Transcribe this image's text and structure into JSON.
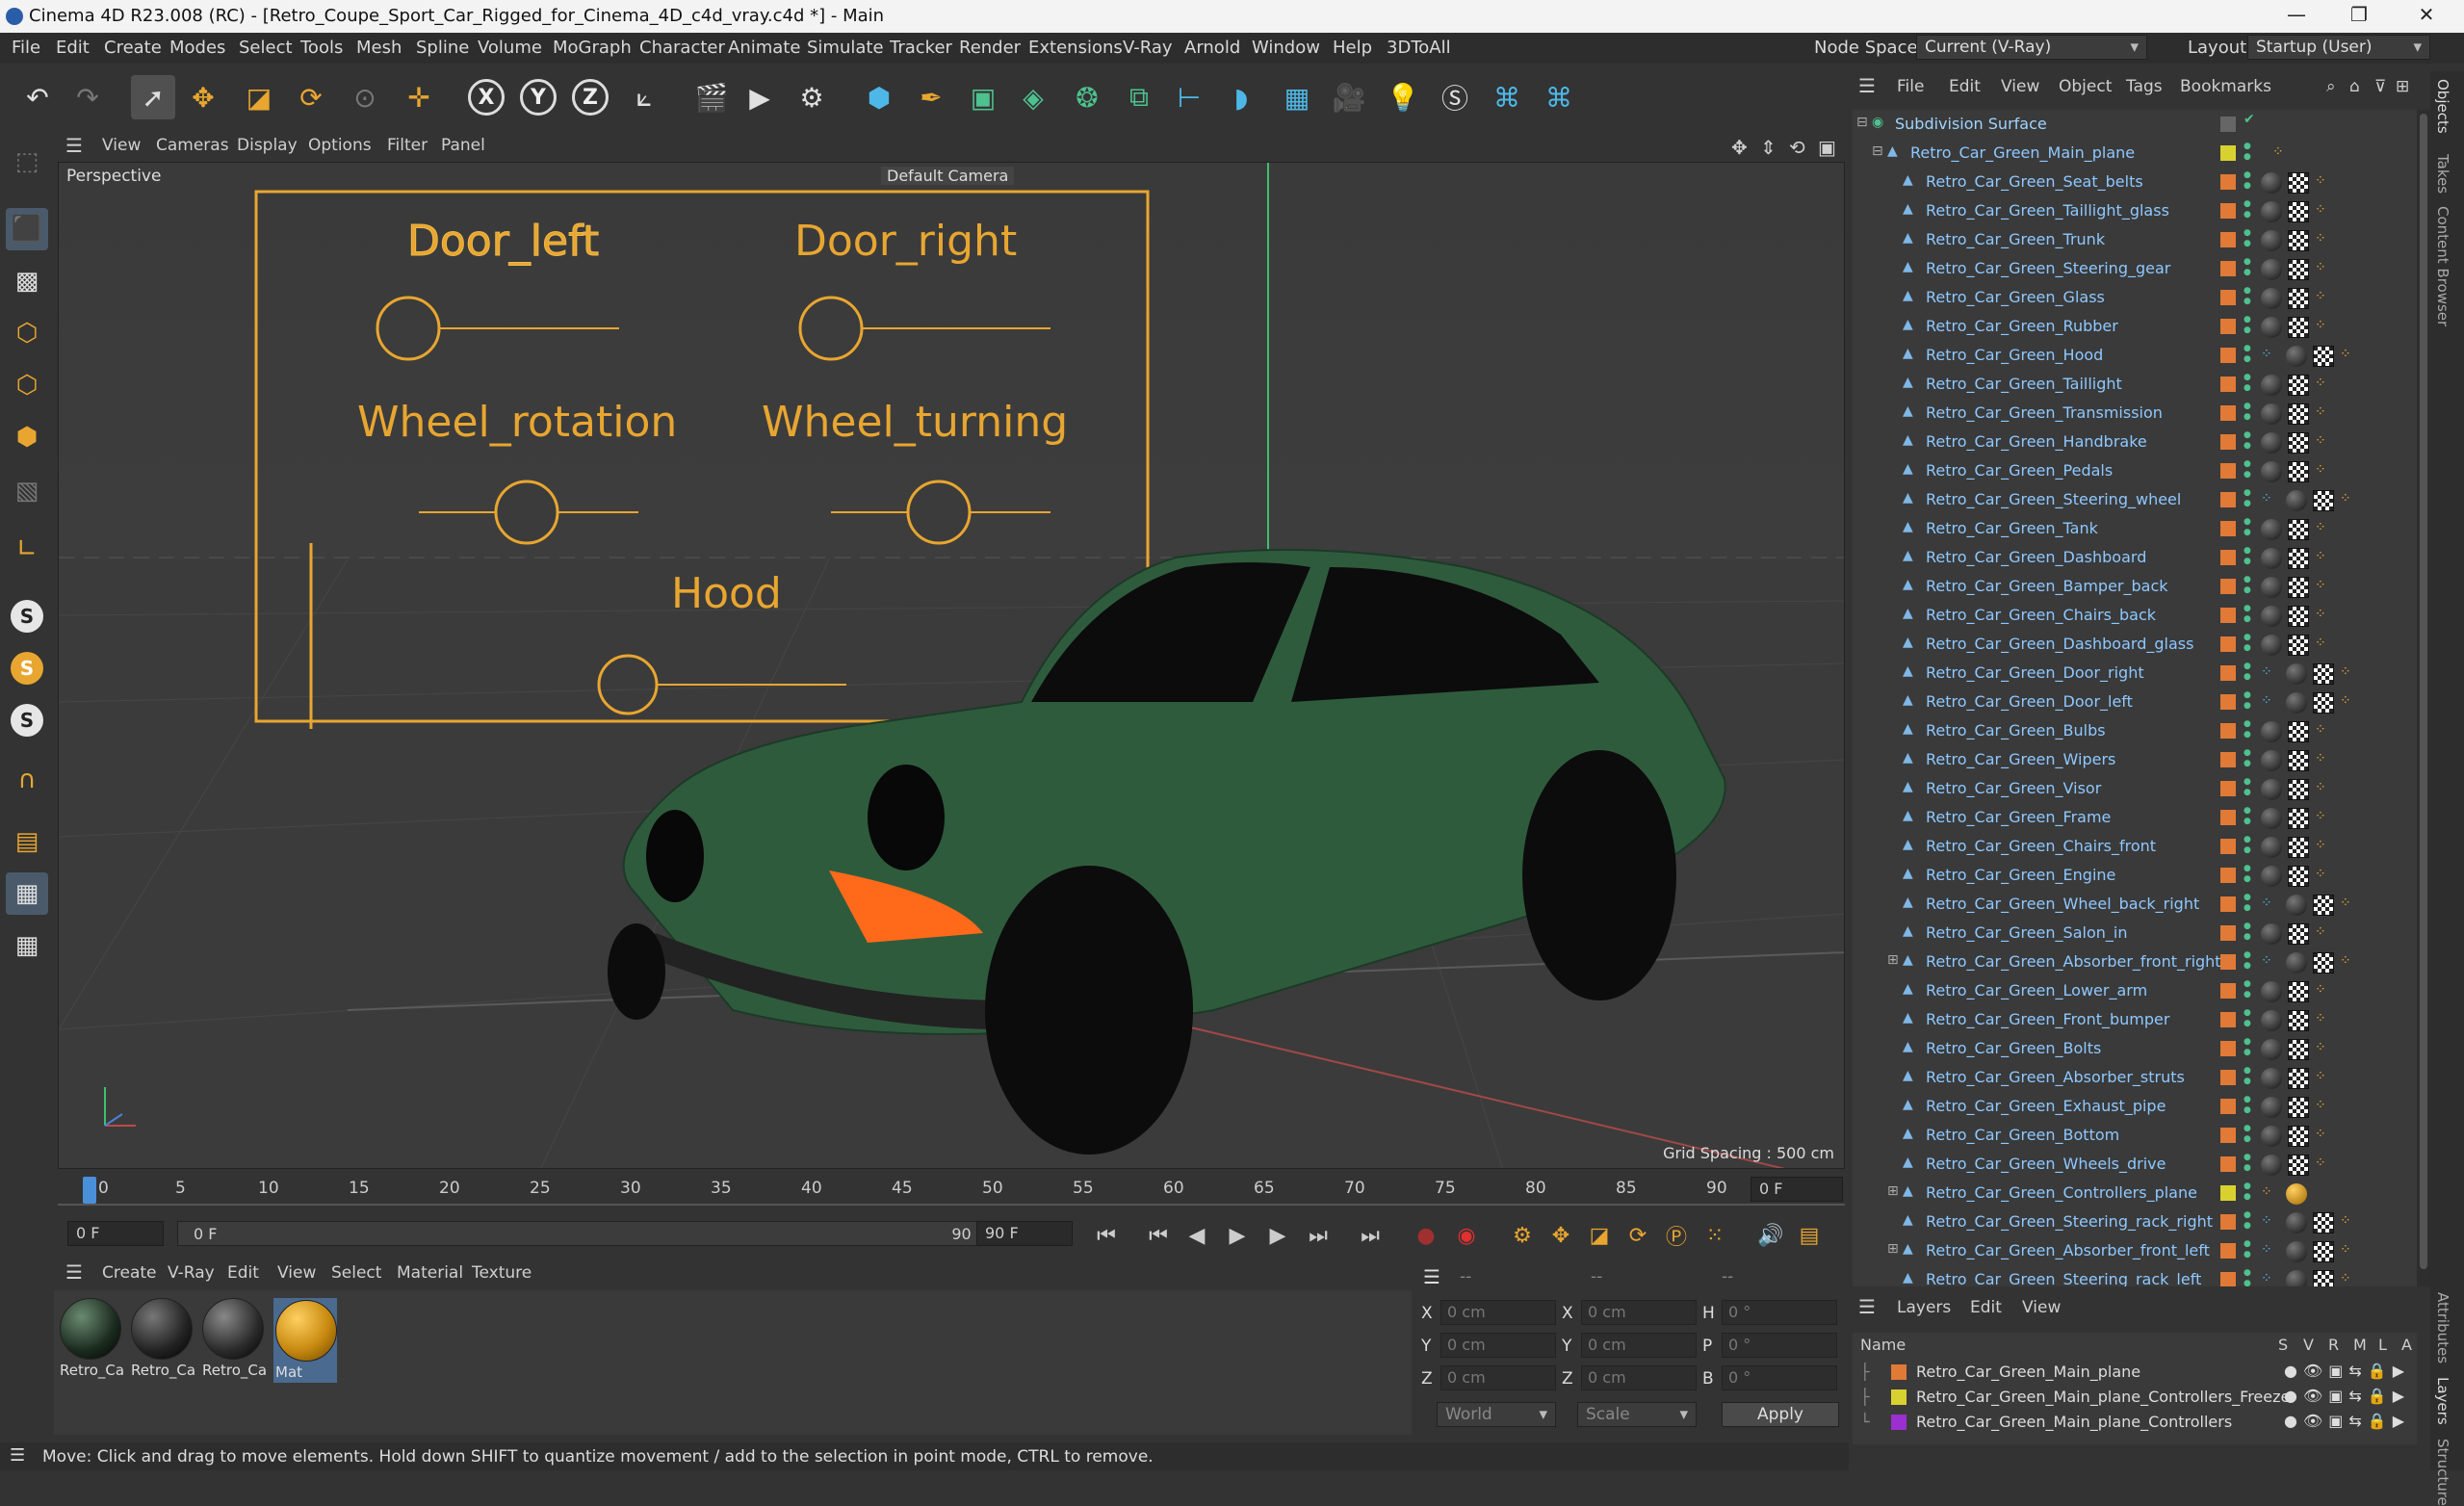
{
  "window": {
    "title": "Cinema 4D R23.008 (RC) - [Retro_Coupe_Sport_Car_Rigged_for_Cinema_4D_c4d_vray.c4d *] - Main",
    "minimize": "—",
    "maximize": "❐",
    "close": "✕"
  },
  "menubar": {
    "items": [
      "File",
      "Edit",
      "Create",
      "Modes",
      "Select",
      "Tools",
      "Mesh",
      "Spline",
      "Volume",
      "MoGraph",
      "Character",
      "Animate",
      "Simulate",
      "Tracker",
      "Render",
      "Extensions",
      "V-Ray",
      "Arnold",
      "Window",
      "Help",
      "3DToAll"
    ],
    "node_space_label": "Node Space:",
    "node_space_value": "Current (V-Ray)",
    "layout_label": "Layout:",
    "layout_value": "Startup (User)"
  },
  "viewport": {
    "menu": [
      "View",
      "Cameras",
      "Display",
      "Options",
      "Filter",
      "Panel"
    ],
    "projection": "Perspective",
    "camera": "Default Camera",
    "grid_spacing": "Grid Spacing : 500 cm",
    "controllers": {
      "door_left": "Door_left",
      "door_right": "Door_right",
      "wheel_rotation": "Wheel_rotation",
      "wheel_turning": "Wheel_turning",
      "hood": "Hood"
    },
    "accent_color": "#e8a630",
    "car_color": "#2e5a3c"
  },
  "timeline": {
    "ticks": [
      "0",
      "5",
      "10",
      "15",
      "20",
      "25",
      "30",
      "35",
      "40",
      "45",
      "50",
      "55",
      "60",
      "65",
      "70",
      "75",
      "80",
      "85",
      "90"
    ],
    "current_frame": "0 F",
    "start": "0 F",
    "range_start": "0 F",
    "range_end": "90 F",
    "end": "90 F",
    "playhead_fraction": 0.0
  },
  "materials": {
    "menu": [
      "Create",
      "V-Ray",
      "Edit",
      "View",
      "Select",
      "Material",
      "Texture"
    ],
    "items": [
      {
        "label": "Retro_Ca"
      },
      {
        "label": "Retro_Ca"
      },
      {
        "label": "Retro_Ca"
      },
      {
        "label": "Mat"
      }
    ]
  },
  "coords": {
    "header": "--",
    "rows": [
      {
        "a": "X",
        "av": "0 cm",
        "b": "X",
        "bv": "0 cm",
        "c": "H",
        "cv": "0 °"
      },
      {
        "a": "Y",
        "av": "0 cm",
        "b": "Y",
        "bv": "0 cm",
        "c": "P",
        "cv": "0 °"
      },
      {
        "a": "Z",
        "av": "0 cm",
        "b": "Z",
        "bv": "0 cm",
        "c": "B",
        "cv": "0 °"
      }
    ],
    "world": "World",
    "scale": "Scale",
    "apply": "Apply"
  },
  "status": "Move: Click and drag to move elements. Hold down SHIFT to quantize movement / add to the selection in point mode, CTRL to remove.",
  "objects": {
    "menu": [
      "File",
      "Edit",
      "View",
      "Object",
      "Tags",
      "Bookmarks"
    ],
    "root": "Subdivision Surface",
    "main": "Retro_Car_Green_Main_plane",
    "children": [
      "Retro_Car_Green_Seat_belts",
      "Retro_Car_Green_Taillight_glass",
      "Retro_Car_Green_Trunk",
      "Retro_Car_Green_Steering_gear",
      "Retro_Car_Green_Glass",
      "Retro_Car_Green_Rubber",
      "Retro_Car_Green_Hood",
      "Retro_Car_Green_Taillight",
      "Retro_Car_Green_Transmission",
      "Retro_Car_Green_Handbrake",
      "Retro_Car_Green_Pedals",
      "Retro_Car_Green_Steering_wheel",
      "Retro_Car_Green_Tank",
      "Retro_Car_Green_Dashboard",
      "Retro_Car_Green_Bamper_back",
      "Retro_Car_Green_Chairs_back",
      "Retro_Car_Green_Dashboard_glass",
      "Retro_Car_Green_Door_right",
      "Retro_Car_Green_Door_left",
      "Retro_Car_Green_Bulbs",
      "Retro_Car_Green_Wipers",
      "Retro_Car_Green_Visor",
      "Retro_Car_Green_Frame",
      "Retro_Car_Green_Chairs_front",
      "Retro_Car_Green_Engine",
      "Retro_Car_Green_Wheel_back_right",
      "Retro_Car_Green_Salon_in",
      "Retro_Car_Green_Absorber_front_right",
      "Retro_Car_Green_Lower_arm",
      "Retro_Car_Green_Front_bumper",
      "Retro_Car_Green_Bolts",
      "Retro_Car_Green_Absorber_struts",
      "Retro_Car_Green_Exhaust_pipe",
      "Retro_Car_Green_Bottom",
      "Retro_Car_Green_Wheels_drive",
      "Retro_Car_Green_Controllers_plane",
      "Retro_Car_Green_Steering_rack_right",
      "Retro_Car_Green_Absorber_front_left",
      "Retro_Car_Green_Steering_rack_left"
    ]
  },
  "layers": {
    "menu": [
      "Layers",
      "Edit",
      "View"
    ],
    "columns": {
      "name": "Name",
      "s": "S",
      "v": "V",
      "r": "R",
      "m": "M",
      "l": "L",
      "a": "A"
    },
    "items": [
      {
        "name": "Retro_Car_Green_Main_plane",
        "color": "#e07a36"
      },
      {
        "name": "Retro_Car_Green_Main_plane_Controllers_Freeze",
        "color": "#d8d230"
      },
      {
        "name": "Retro_Car_Green_Main_plane_Controllers",
        "color": "#9b2fd0"
      }
    ]
  },
  "sidetabs": [
    "Objects",
    "Takes",
    "Content Browser",
    "Attributes",
    "Layers",
    "Structure"
  ]
}
